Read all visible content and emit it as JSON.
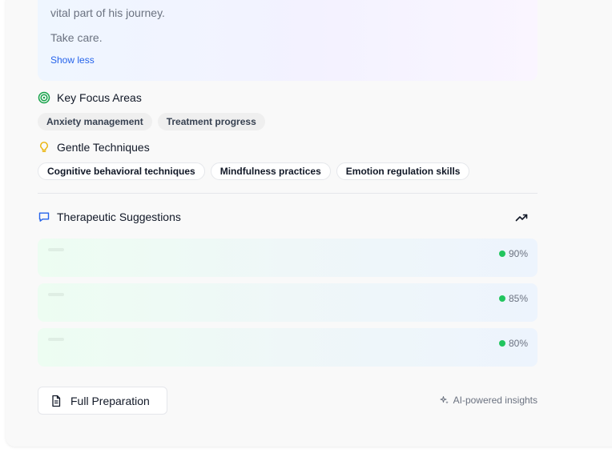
{
  "summary": {
    "line1": "vital part of his journey.",
    "line2": "Take care.",
    "toggle_label": "Show less"
  },
  "focus": {
    "title": "Key Focus Areas",
    "chips": [
      "Anxiety management",
      "Treatment progress"
    ]
  },
  "techniques": {
    "title": "Gentle Techniques",
    "chips": [
      "Cognitive behavioral techniques",
      "Mindfulness practices",
      "Emotion regulation skills"
    ]
  },
  "suggestions": {
    "title": "Therapeutic Suggestions",
    "items": [
      {
        "score": "90%",
        "confidence": 0.9
      },
      {
        "score": "85%",
        "confidence": 0.85
      },
      {
        "score": "80%",
        "confidence": 0.8
      }
    ]
  },
  "footer": {
    "full_prep_label": "Full Preparation",
    "ai_label": "AI-powered insights"
  },
  "icons": {
    "focus": "target-icon",
    "techniques": "lightbulb-icon",
    "suggestions": "message-icon",
    "trend": "trending-up-icon",
    "document": "document-icon",
    "sparkles": "sparkles-icon"
  },
  "colors": {
    "accent_blue": "#2563eb",
    "focus_green": "#16a34a",
    "bulb_yellow": "#eab308",
    "score_dot": "#22c55e"
  }
}
